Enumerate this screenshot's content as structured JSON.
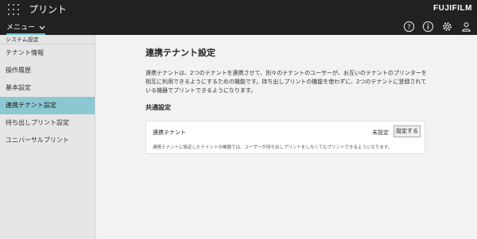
{
  "header": {
    "app_title": "プリント",
    "brand": "FUJIFILM",
    "apps_icon": "grid-icon"
  },
  "menubar": {
    "menu_label": "メニュー",
    "icons": [
      "help-icon",
      "info-icon",
      "settings-icon",
      "user-icon"
    ]
  },
  "sidebar": {
    "section_label": "システム設定",
    "items": [
      {
        "label": "テナント情報"
      },
      {
        "label": "操作履歴"
      },
      {
        "label": "基本設定"
      },
      {
        "label": "連携テナント設定",
        "active": true
      },
      {
        "label": "持ち出しプリント設定"
      },
      {
        "label": "ユニバーサルプリント"
      }
    ]
  },
  "main": {
    "title": "連携テナント設定",
    "description": "連携テナントは、2つのテナントを連携させて、別々のテナントのユーザーが、お互いのテナントのプリンターを相互に利用できるようにするための機能です。持ち出しプリントの機能を使わずに、2つのテナントに登録されている機器でプリントできるようになります。",
    "section_title": "共通設定",
    "card": {
      "label": "連携テナント",
      "status": "未設定",
      "button_label": "設定する",
      "note": "連携テナントに設定したテナントの機器では、ユーザーが持ち出しプリントをしなくてもプリントできるようになります。"
    }
  },
  "colors": {
    "header_bg": "#212121",
    "accent": "#66c1c8",
    "active_item_bg": "#8cc8d1",
    "sidebar_bg": "#e6e6e6",
    "content_bg": "#f2f2f2"
  }
}
